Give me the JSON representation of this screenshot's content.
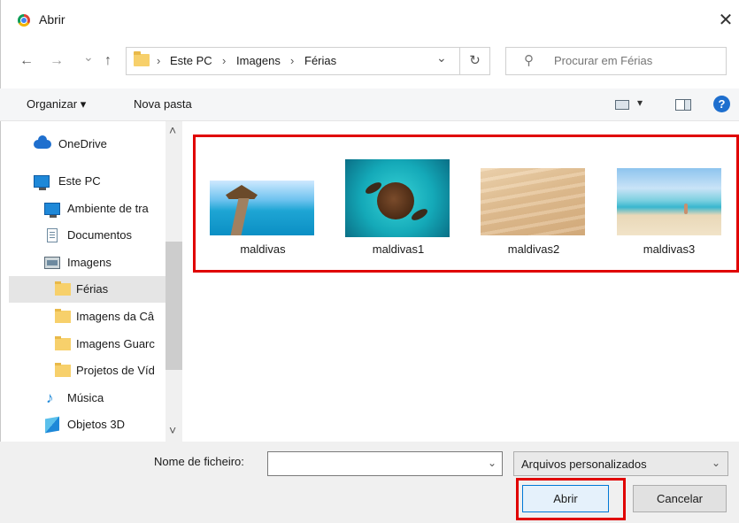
{
  "window": {
    "title": "Abrir",
    "close_glyph": "✕"
  },
  "nav": {
    "back_glyph": "←",
    "forward_glyph": "→",
    "recent_glyph": "⌄",
    "up_glyph": "↑",
    "breadcrumb": [
      "Este PC",
      "Imagens",
      "Férias"
    ],
    "breadcrumb_sep": "›",
    "dropdown_glyph": "⌄",
    "refresh_glyph": "↻",
    "search_icon_glyph": "⚲",
    "search_placeholder": "Procurar em Férias"
  },
  "toolbar": {
    "organize_label": "Organizar ▾",
    "new_folder_label": "Nova pasta",
    "view_dropdown_glyph": "▾",
    "help_glyph": "?"
  },
  "sidebar": {
    "items": [
      {
        "label": "OneDrive",
        "icon": "onedrive-cloud-icon"
      },
      {
        "label": "Este PC",
        "icon": "monitor-icon"
      },
      {
        "label": "Ambiente de tra",
        "icon": "desktop-icon"
      },
      {
        "label": "Documentos",
        "icon": "documents-icon"
      },
      {
        "label": "Imagens",
        "icon": "images-icon"
      },
      {
        "label": "Férias",
        "icon": "folder-icon",
        "selected": true
      },
      {
        "label": "Imagens da Câ",
        "icon": "folder-icon"
      },
      {
        "label": "Imagens Guarc",
        "icon": "folder-icon"
      },
      {
        "label": "Projetos de Víd",
        "icon": "folder-icon"
      },
      {
        "label": "Música",
        "icon": "music-icon"
      },
      {
        "label": "Objetos 3D",
        "icon": "3d-objects-icon"
      }
    ],
    "scroll_up_glyph": "˄",
    "scroll_down_glyph": "˅"
  },
  "files": [
    {
      "name": "maldivas"
    },
    {
      "name": "maldivas1"
    },
    {
      "name": "maldivas2"
    },
    {
      "name": "maldivas3"
    }
  ],
  "footer": {
    "filename_label": "Nome de ficheiro:",
    "filename_value": "",
    "filetype_value": "Arquivos personalizados",
    "chevron_glyph": "⌄",
    "open_label": "Abrir",
    "cancel_label": "Cancelar"
  },
  "colors": {
    "highlight": "#e00000",
    "accent": "#0078d7",
    "folder": "#f7d06b"
  }
}
